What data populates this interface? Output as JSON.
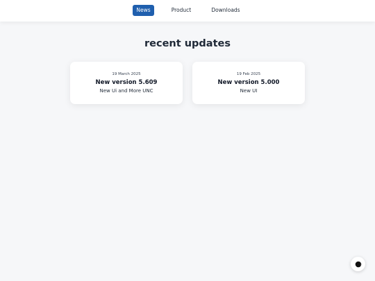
{
  "nav": {
    "items": [
      {
        "label": "News",
        "active": true
      },
      {
        "label": "Product",
        "active": false
      },
      {
        "label": "Downloads",
        "active": false
      }
    ]
  },
  "main": {
    "title": "recent updates",
    "updates": [
      {
        "date": "19 March 2025",
        "title": "New version 5.609",
        "description": "New Ui and More UNC"
      },
      {
        "date": "19 Feb 2025",
        "title": "New version 5.000",
        "description": "New UI"
      }
    ]
  },
  "theme_toggle": {
    "icon": "half-moon-icon"
  },
  "colors": {
    "accent": "#1f5fae",
    "background": "#f6f7f9",
    "card": "#ffffff"
  }
}
